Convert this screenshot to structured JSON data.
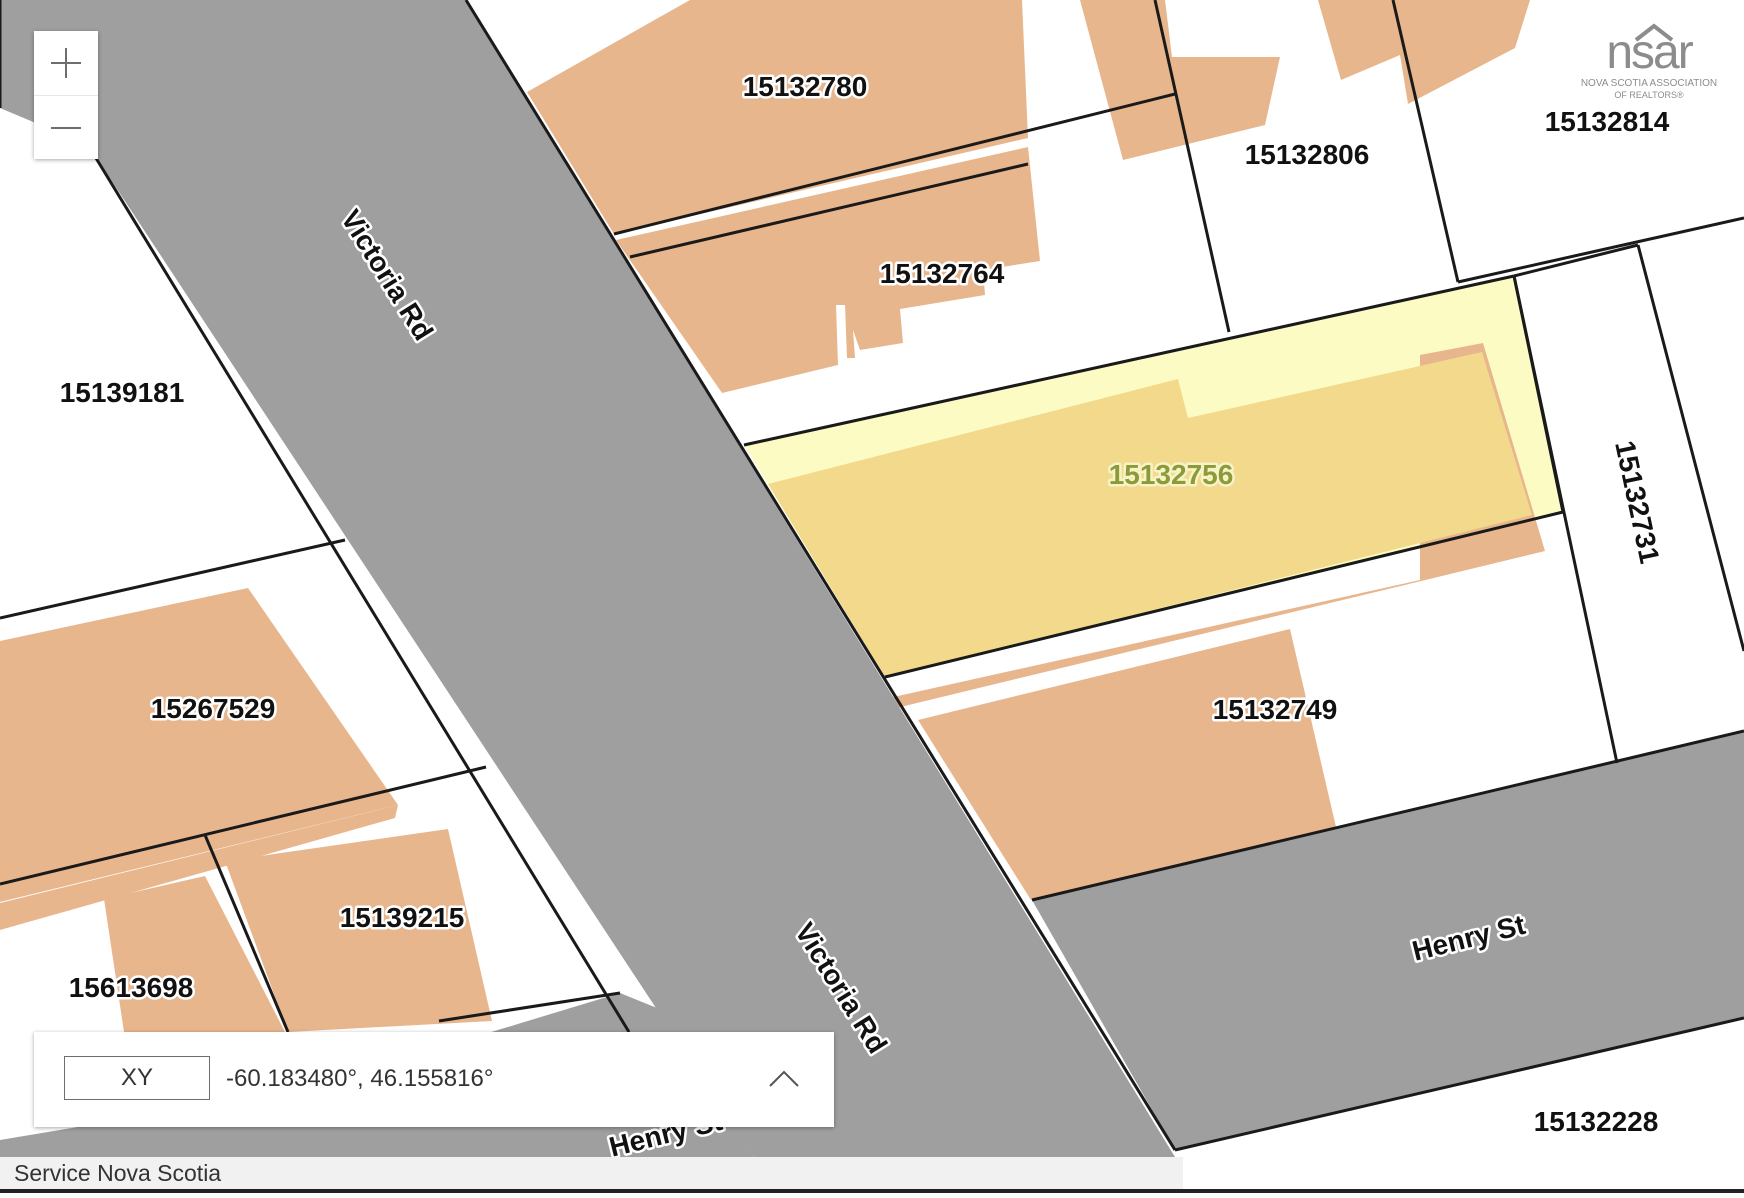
{
  "map": {
    "parcels": [
      {
        "id": "15132780"
      },
      {
        "id": "15132806"
      },
      {
        "id": "15132814"
      },
      {
        "id": "15132764"
      },
      {
        "id": "15139181"
      },
      {
        "id": "15132756",
        "selected": true
      },
      {
        "id": "15132731"
      },
      {
        "id": "15267529"
      },
      {
        "id": "15132749"
      },
      {
        "id": "15139215"
      },
      {
        "id": "15613698"
      },
      {
        "id": "15132228"
      }
    ],
    "streets": [
      {
        "name": "Victoria Rd"
      },
      {
        "name": "Victoria Rd"
      },
      {
        "name": "Henry St"
      },
      {
        "name": "Henry St"
      }
    ],
    "colors": {
      "road": "#9f9f9f",
      "building": "#e8b68d",
      "selected_parcel": "#fdfbc4",
      "selected_building": "#f3d98b",
      "parcel_line": "#1a1a1a"
    }
  },
  "zoom": {
    "in_icon": "plus-icon",
    "out_icon": "minus-icon"
  },
  "coordinates": {
    "mode_label": "XY",
    "value": "-60.183480°, 46.155816°",
    "toggle_icon": "chevron-up-icon"
  },
  "attribution": "Service Nova Scotia",
  "logo": {
    "text": "nsar",
    "line1": "NOVA SCOTIA ASSOCIATION",
    "line2": "OF REALTORS®"
  }
}
